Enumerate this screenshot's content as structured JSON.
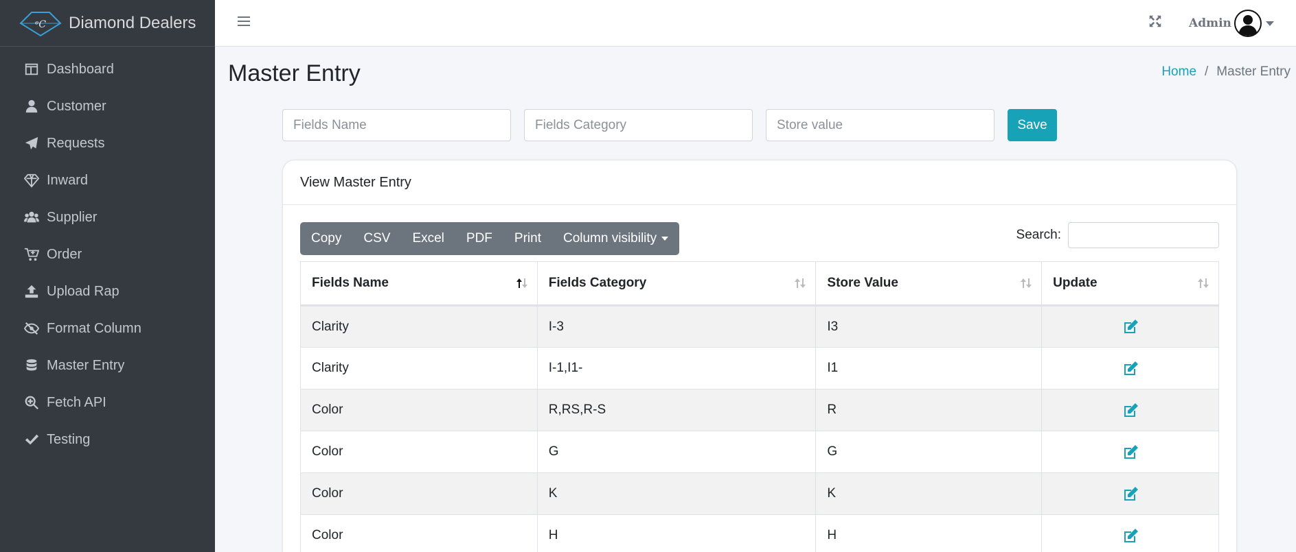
{
  "brand": {
    "name": "Diamond Dealers"
  },
  "sidebar": {
    "items": [
      {
        "label": "Dashboard",
        "icon": "dashboard-icon"
      },
      {
        "label": "Customer",
        "icon": "user-icon"
      },
      {
        "label": "Requests",
        "icon": "paper-plane-icon"
      },
      {
        "label": "Inward",
        "icon": "diamond-icon"
      },
      {
        "label": "Supplier",
        "icon": "users-icon"
      },
      {
        "label": "Order",
        "icon": "cart-plus-icon"
      },
      {
        "label": "Upload Rap",
        "icon": "upload-icon"
      },
      {
        "label": "Format Column",
        "icon": "eye-slash-icon"
      },
      {
        "label": "Master Entry",
        "icon": "database-icon"
      },
      {
        "label": "Fetch API",
        "icon": "search-plus-icon"
      },
      {
        "label": "Testing",
        "icon": "check-icon"
      }
    ]
  },
  "topbar": {
    "user_name": "Admin"
  },
  "page": {
    "title": "Master Entry"
  },
  "breadcrumb": {
    "home": "Home",
    "separator": "/",
    "current": "Master Entry"
  },
  "form": {
    "fields_name_placeholder": "Fields Name",
    "fields_category_placeholder": "Fields Category",
    "store_value_placeholder": "Store value",
    "save_label": "Save"
  },
  "card": {
    "title": "View Master Entry"
  },
  "toolbar": {
    "buttons": [
      "Copy",
      "CSV",
      "Excel",
      "PDF",
      "Print",
      "Column visibility"
    ],
    "search_label": "Search:"
  },
  "table": {
    "headers": [
      "Fields Name",
      "Fields Category",
      "Store Value",
      "Update"
    ],
    "rows": [
      {
        "name": "Clarity",
        "category": "I-3",
        "value": "I3"
      },
      {
        "name": "Clarity",
        "category": "I-1,I1-",
        "value": "I1"
      },
      {
        "name": "Color",
        "category": "R,RS,R-S",
        "value": "R"
      },
      {
        "name": "Color",
        "category": "G",
        "value": "G"
      },
      {
        "name": "Color",
        "category": "K",
        "value": "K"
      },
      {
        "name": "Color",
        "category": "H",
        "value": "H"
      }
    ]
  },
  "colors": {
    "sidebar_bg": "#343a40",
    "accent": "#17a2b8",
    "button_group_bg": "#6c757d"
  }
}
